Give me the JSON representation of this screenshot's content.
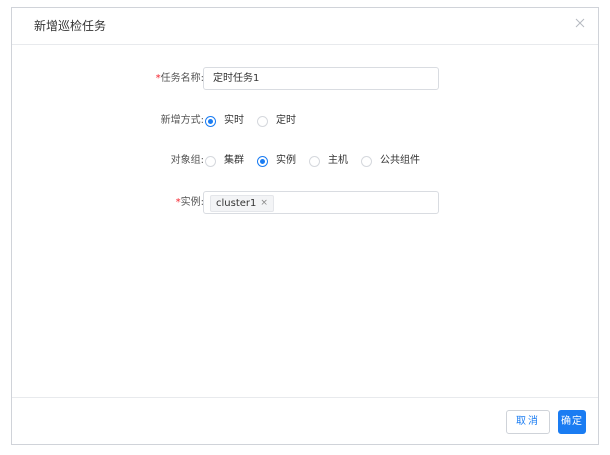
{
  "dialog": {
    "title": "新增巡检任务",
    "close_icon": "close-icon"
  },
  "form": {
    "task_name": {
      "required_mark": "*",
      "label": "任务名称:",
      "value": "定时任务1"
    },
    "add_mode": {
      "label": "新增方式:",
      "options": [
        {
          "label": "实时",
          "checked": true
        },
        {
          "label": "定时",
          "checked": false
        }
      ]
    },
    "object_group": {
      "label": "对象组:",
      "options": [
        {
          "label": "集群",
          "checked": false
        },
        {
          "label": "实例",
          "checked": true
        },
        {
          "label": "主机",
          "checked": false
        },
        {
          "label": "公共组件",
          "checked": false
        }
      ]
    },
    "instance": {
      "required_mark": "*",
      "label": "实例:",
      "tags": [
        {
          "label": "cluster1",
          "close": "×"
        }
      ]
    }
  },
  "footer": {
    "cancel_label": "取消",
    "ok_label": "确定"
  },
  "colors": {
    "accent": "#1a7cf2",
    "required": "#f5222d",
    "border": "#d9dce1"
  }
}
